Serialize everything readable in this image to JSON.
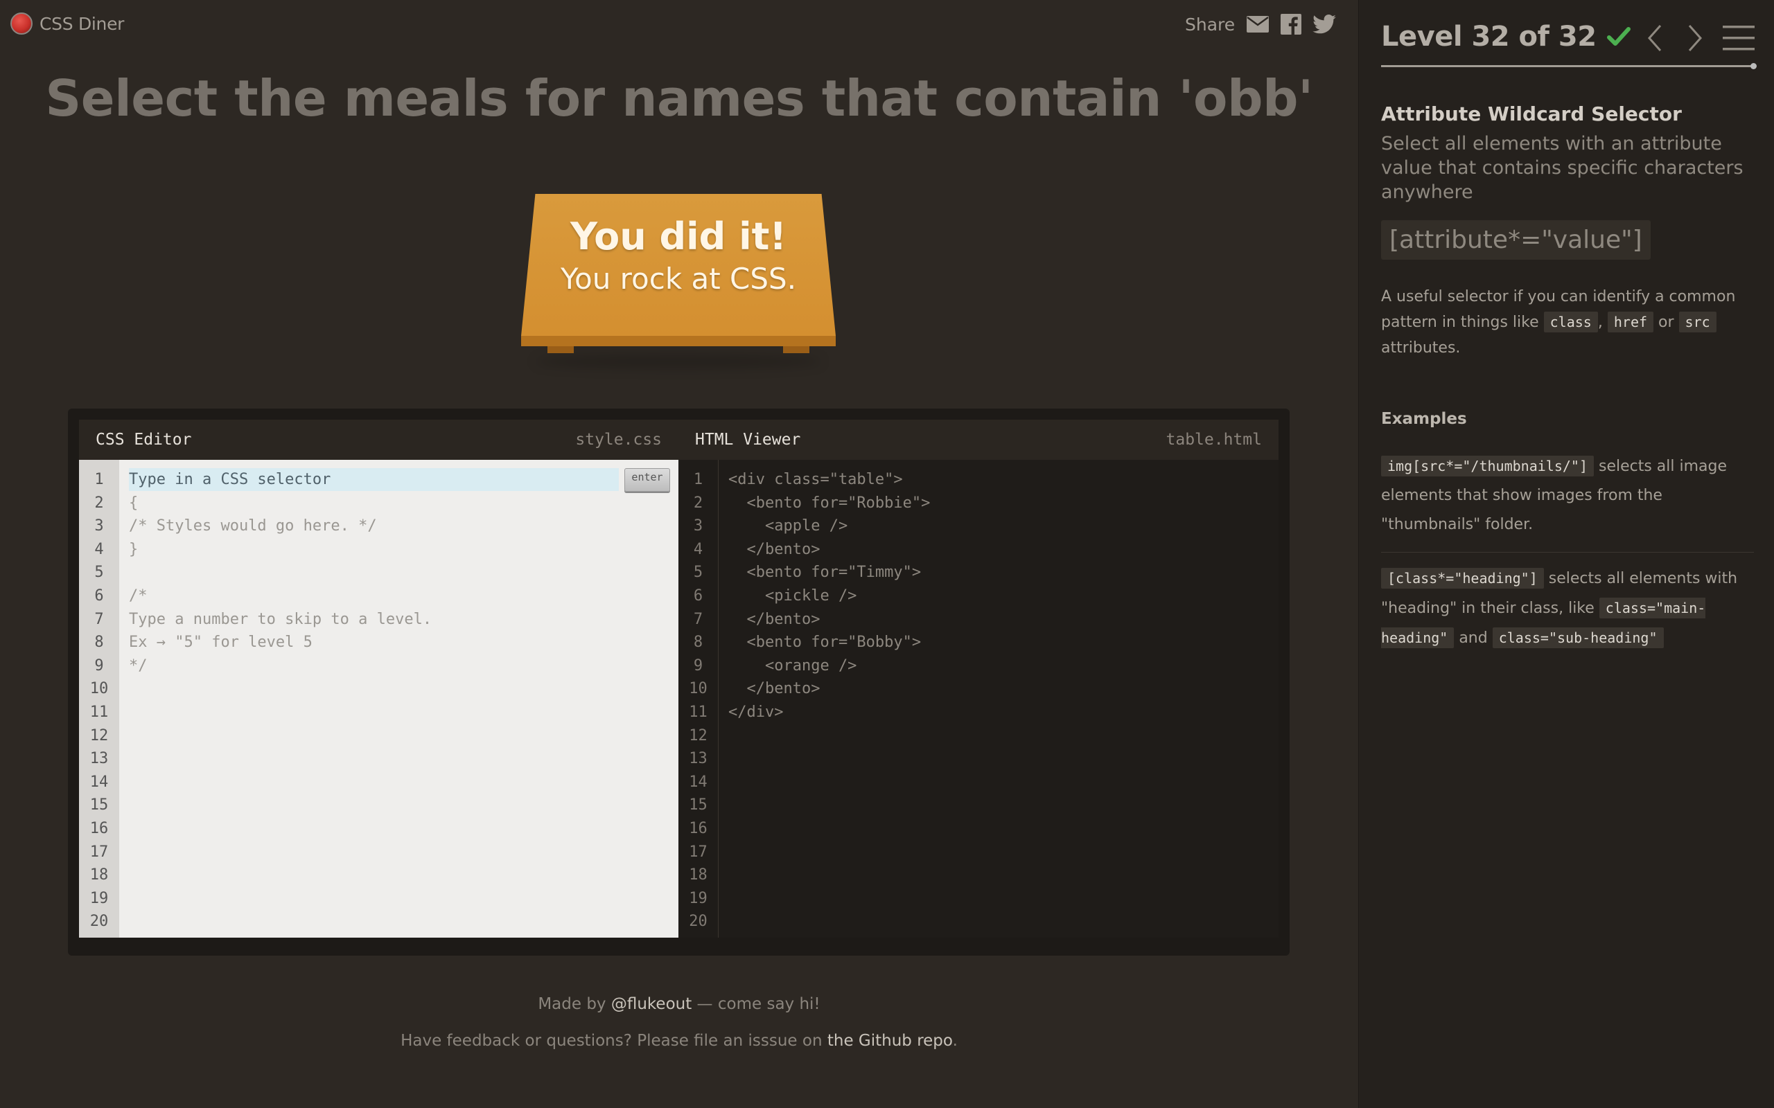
{
  "app": {
    "logo_text": "CSS Diner"
  },
  "share": {
    "label": "Share",
    "icons": [
      "envelope-icon",
      "facebook-icon",
      "twitter-icon"
    ]
  },
  "instruction": "Select the meals for names that contain 'obb'",
  "table": {
    "line1": "You did it!",
    "line2": "You rock at CSS."
  },
  "css_editor": {
    "title": "CSS Editor",
    "file": "style.css",
    "placeholder": "Type in a CSS selector",
    "enter_label": "enter",
    "lines": [
      "",
      "{",
      "/* Styles would go here. */",
      "}",
      "",
      "/*",
      "Type a number to skip to a level.",
      "Ex → \"5\" for level 5",
      "*/"
    ],
    "line_numbers": [
      "1",
      "2",
      "3",
      "4",
      "5",
      "6",
      "7",
      "8",
      "9",
      "10",
      "11",
      "12",
      "13",
      "14",
      "15",
      "16",
      "17",
      "18",
      "19",
      "20"
    ]
  },
  "html_viewer": {
    "title": "HTML Viewer",
    "file": "table.html",
    "lines": [
      "<div class=\"table\">",
      "  <bento for=\"Robbie\">",
      "    <apple />",
      "  </bento>",
      "  <bento for=\"Timmy\">",
      "    <pickle />",
      "  </bento>",
      "  <bento for=\"Bobby\">",
      "    <orange />",
      "  </bento>",
      "</div>"
    ],
    "line_numbers": [
      "1",
      "2",
      "3",
      "4",
      "5",
      "6",
      "7",
      "8",
      "9",
      "10",
      "11",
      "12",
      "13",
      "14",
      "15",
      "16",
      "17",
      "18",
      "19",
      "20"
    ]
  },
  "footer": {
    "made_by_prefix": "Made by ",
    "made_by_link": "@flukeout",
    "made_by_suffix": " — come say hi!",
    "feedback_prefix": "Have feedback or questions? Please file an isssue on ",
    "feedback_link": "the Github repo",
    "feedback_suffix": "."
  },
  "sidebar": {
    "level_text": "Level 32 of 32",
    "progress": 1.0,
    "selector_name": "Attribute Wildcard Selector",
    "selector_title": "Select all elements with an attribute value that contains specific characters anywhere",
    "syntax": "[attribute*=\"value\"]",
    "hint_before": "A useful selector if you can identify a common pattern in things like ",
    "hint_code1": "class",
    "hint_sep1": ", ",
    "hint_code2": "href",
    "hint_sep2": " or ",
    "hint_code3": "src",
    "hint_after": " attributes.",
    "examples_heading": "Examples",
    "example1_code": "img[src*=\"/thumbnails/\"]",
    "example1_text": " selects all image elements that show images from the \"thumbnails\" folder.",
    "example2_code": "[class*=\"heading\"]",
    "example2_text1": " selects all elements with \"heading\" in their class, like ",
    "example2_code2": "class=\"main-heading\"",
    "example2_text2": " and ",
    "example2_code3": "class=\"sub-heading\""
  },
  "colors": {
    "background": "#2d2823",
    "table": "#d99a3c",
    "check": "#4caf50"
  }
}
